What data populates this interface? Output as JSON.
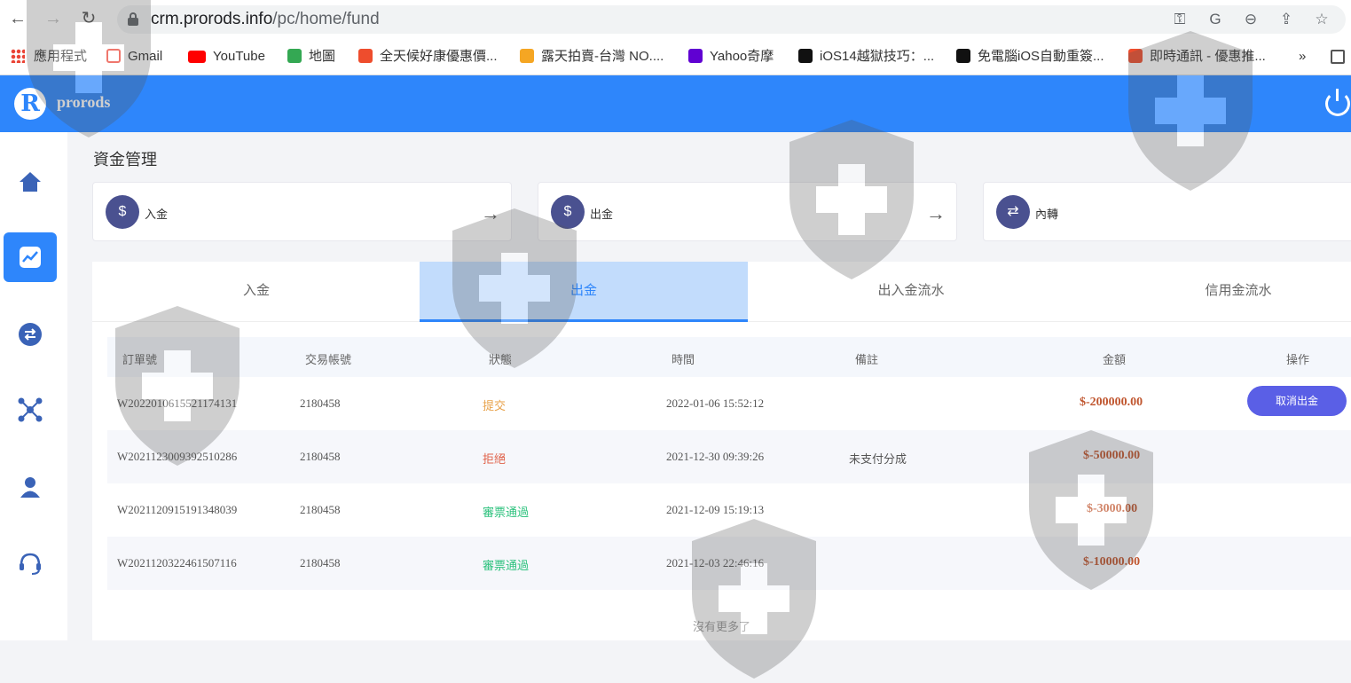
{
  "browser": {
    "url_host": "crm.prorods.info",
    "url_path": "/pc/home/fund",
    "bookmarks": [
      {
        "label": "應用程式",
        "color": "#ea4335"
      },
      {
        "label": "Gmail",
        "color": "#ea4335"
      },
      {
        "label": "YouTube",
        "color": "#ff0000"
      },
      {
        "label": "地圖",
        "color": "#34a853"
      },
      {
        "label": "全天候好康優惠價...",
        "color": "#ee4d2d"
      },
      {
        "label": "露天拍賣-台灣 NO....",
        "color": "#f5a623"
      },
      {
        "label": "Yahoo奇摩",
        "color": "#6001d2"
      },
      {
        "label": "iOS14越獄技巧：...",
        "color": "#111111"
      },
      {
        "label": "免電腦iOS自動重簽...",
        "color": "#111111"
      },
      {
        "label": "即時通訊 - 優惠推...",
        "color": "#ee4d2d"
      }
    ],
    "more": "»"
  },
  "header": {
    "logo_letter": "R",
    "brand": "prorods"
  },
  "page": {
    "title": "資金管理"
  },
  "cards": [
    {
      "label": "入金",
      "icon": "$"
    },
    {
      "label": "出金",
      "icon": "$"
    },
    {
      "label": "內轉",
      "icon": "⇄"
    }
  ],
  "tabs": [
    {
      "label": "入金"
    },
    {
      "label": "出金"
    },
    {
      "label": "出入金流水"
    },
    {
      "label": "信用金流水"
    }
  ],
  "table": {
    "headers": [
      "訂單號",
      "交易帳號",
      "狀態",
      "時間",
      "備註",
      "金額",
      "操作"
    ],
    "rows": [
      {
        "order": "W2022010615521174131",
        "account": "2180458",
        "status": "提交",
        "status_color": "#e8a24a",
        "time": "2022-01-06 15:52:12",
        "note": "",
        "amount": "$-200000.00",
        "action": "取消出金"
      },
      {
        "order": "W2021123009392510286",
        "account": "2180458",
        "status": "拒絕",
        "status_color": "#e0624a",
        "time": "2021-12-30 09:39:26",
        "note": "未支付分成",
        "amount": "$-50000.00",
        "action": ""
      },
      {
        "order": "W2021120915191348039",
        "account": "2180458",
        "status": "審票通過",
        "status_color": "#2ec27e",
        "time": "2021-12-09 15:19:13",
        "note": "",
        "amount": "$-3000.00",
        "action": ""
      },
      {
        "order": "W2021120322461507116",
        "account": "2180458",
        "status": "審票通過",
        "status_color": "#2ec27e",
        "time": "2021-12-03 22:46:16",
        "note": "",
        "amount": "$-10000.00",
        "action": ""
      }
    ],
    "footer": "沒有更多了"
  },
  "colors": {
    "primary": "#2e86fb",
    "amount": "#c0562f",
    "button": "#5a5fe6"
  }
}
